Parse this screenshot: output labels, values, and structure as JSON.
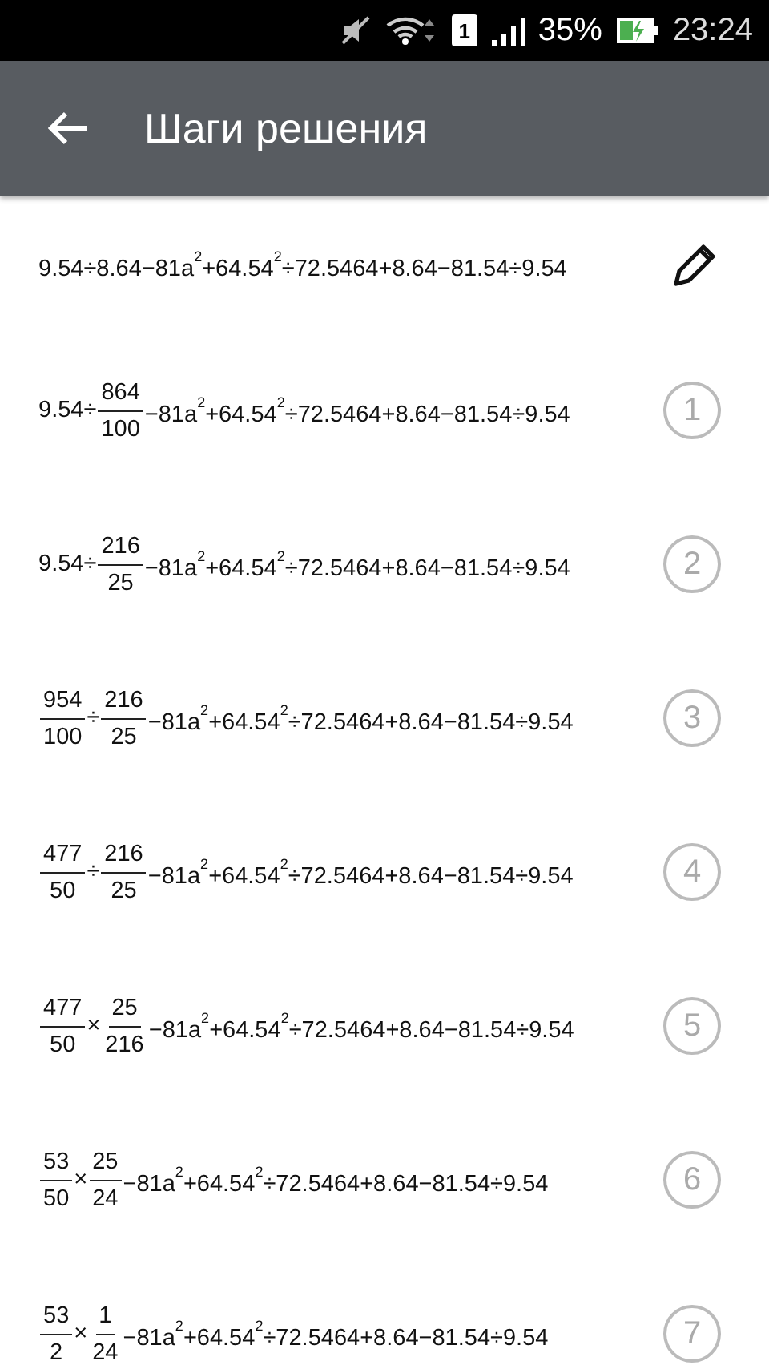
{
  "status_bar": {
    "sim": "1",
    "battery": "35%",
    "time": "23:24"
  },
  "app_bar": {
    "title": "Шаги решения"
  },
  "original": {
    "tokens": [
      {
        "kind": "text",
        "text": "9.54÷8.64−81a$^{2}$+64.54$^{2}$÷72.5464+8.64−81.54÷9.54"
      }
    ]
  },
  "steps": [
    {
      "number": "1",
      "tokens": [
        {
          "kind": "text",
          "text": "9.54÷"
        },
        {
          "kind": "frac",
          "num": "864",
          "den": "100"
        },
        {
          "kind": "text",
          "text": "−81a$^{2}$+64.54$^{2}$÷72.5464+8.64−81.54÷9.54"
        }
      ]
    },
    {
      "number": "2",
      "tokens": [
        {
          "kind": "text",
          "text": "9.54÷"
        },
        {
          "kind": "frac",
          "num": "216",
          "den": "25"
        },
        {
          "kind": "text",
          "text": "−81a$^{2}$+64.54$^{2}$÷72.5464+8.64−81.54÷9.54"
        }
      ]
    },
    {
      "number": "3",
      "tokens": [
        {
          "kind": "frac",
          "num": "954",
          "den": "100"
        },
        {
          "kind": "text",
          "text": "÷"
        },
        {
          "kind": "frac",
          "num": "216",
          "den": "25"
        },
        {
          "kind": "text",
          "text": "−81a$^{2}$+64.54$^{2}$÷72.5464+8.64−81.54÷9.54"
        }
      ]
    },
    {
      "number": "4",
      "tokens": [
        {
          "kind": "frac",
          "num": "477",
          "den": "50"
        },
        {
          "kind": "text",
          "text": "÷"
        },
        {
          "kind": "frac",
          "num": "216",
          "den": "25"
        },
        {
          "kind": "text",
          "text": "−81a$^{2}$+64.54$^{2}$÷72.5464+8.64−81.54÷9.54"
        }
      ]
    },
    {
      "number": "5",
      "tokens": [
        {
          "kind": "frac",
          "num": "477",
          "den": "50"
        },
        {
          "kind": "text",
          "text": "×"
        },
        {
          "kind": "frac",
          "num": "25",
          "den": "216"
        },
        {
          "kind": "text",
          "text": "−81a$^{2}$+64.54$^{2}$÷72.5464+8.64−81.54÷9.54"
        }
      ]
    },
    {
      "number": "6",
      "tokens": [
        {
          "kind": "frac",
          "num": "53",
          "den": "50"
        },
        {
          "kind": "text",
          "text": "×"
        },
        {
          "kind": "frac",
          "num": "25",
          "den": "24"
        },
        {
          "kind": "text",
          "text": "−81a$^{2}$+64.54$^{2}$÷72.5464+8.64−81.54÷9.54"
        }
      ]
    },
    {
      "number": "7",
      "tokens": [
        {
          "kind": "frac",
          "num": "53",
          "den": "2"
        },
        {
          "kind": "text",
          "text": "×"
        },
        {
          "kind": "frac",
          "num": "1",
          "den": "24"
        },
        {
          "kind": "text",
          "text": "−81a$^{2}$+64.54$^{2}$÷72.5464+8.64−81.54÷9.54"
        }
      ]
    }
  ]
}
